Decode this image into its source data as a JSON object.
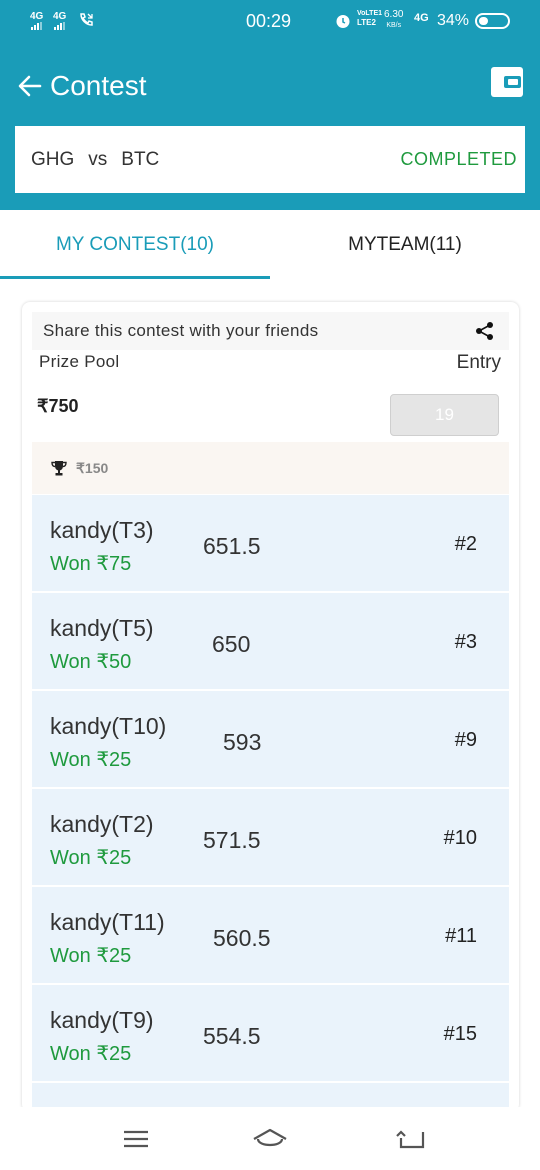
{
  "status_bar": {
    "network_1": "4G",
    "network_2": "4G",
    "time": "00:29",
    "volte_1": "VoLTE1",
    "volte_2": "LTE2",
    "speed_value": "6.30",
    "speed_unit": "KB/s",
    "network_3": "4G",
    "battery": "34%"
  },
  "app_bar": {
    "title": "Contest"
  },
  "match": {
    "team_a": "GHG",
    "vs": "vs",
    "team_b": "BTC",
    "status": "COMPLETED"
  },
  "tabs": [
    {
      "label": "MY CONTEST(10)",
      "active": true
    },
    {
      "label": "MYTEAM(11)",
      "active": false
    }
  ],
  "contest": {
    "share_text": "Share this contest with your friends",
    "prize_pool_label": "Prize Pool",
    "entry_label": "Entry",
    "prize_pool_value": "₹750",
    "entry_value": "19",
    "first_prize": "₹150"
  },
  "leaderboard": [
    {
      "name": "kandy(T3)",
      "won": "Won ₹75",
      "points": "651.5",
      "rank": "#2"
    },
    {
      "name": "kandy(T5)",
      "won": "Won ₹50",
      "points": "650",
      "rank": "#3"
    },
    {
      "name": "kandy(T10)",
      "won": "Won ₹25",
      "points": "593",
      "rank": "#9"
    },
    {
      "name": "kandy(T2)",
      "won": "Won ₹25",
      "points": "571.5",
      "rank": "#10"
    },
    {
      "name": "kandy(T11)",
      "won": "Won ₹25",
      "points": "560.5",
      "rank": "#11"
    },
    {
      "name": "kandy(T9)",
      "won": "Won ₹25",
      "points": "554.5",
      "rank": "#15"
    }
  ],
  "colors": {
    "primary": "#1a9cb8",
    "success": "#1f9a3e",
    "row_background": "#eaf3fb"
  },
  "icons": {
    "back": "arrow-left-icon",
    "wallet": "wallet-icon",
    "share": "share-icon",
    "trophy": "trophy-icon"
  }
}
